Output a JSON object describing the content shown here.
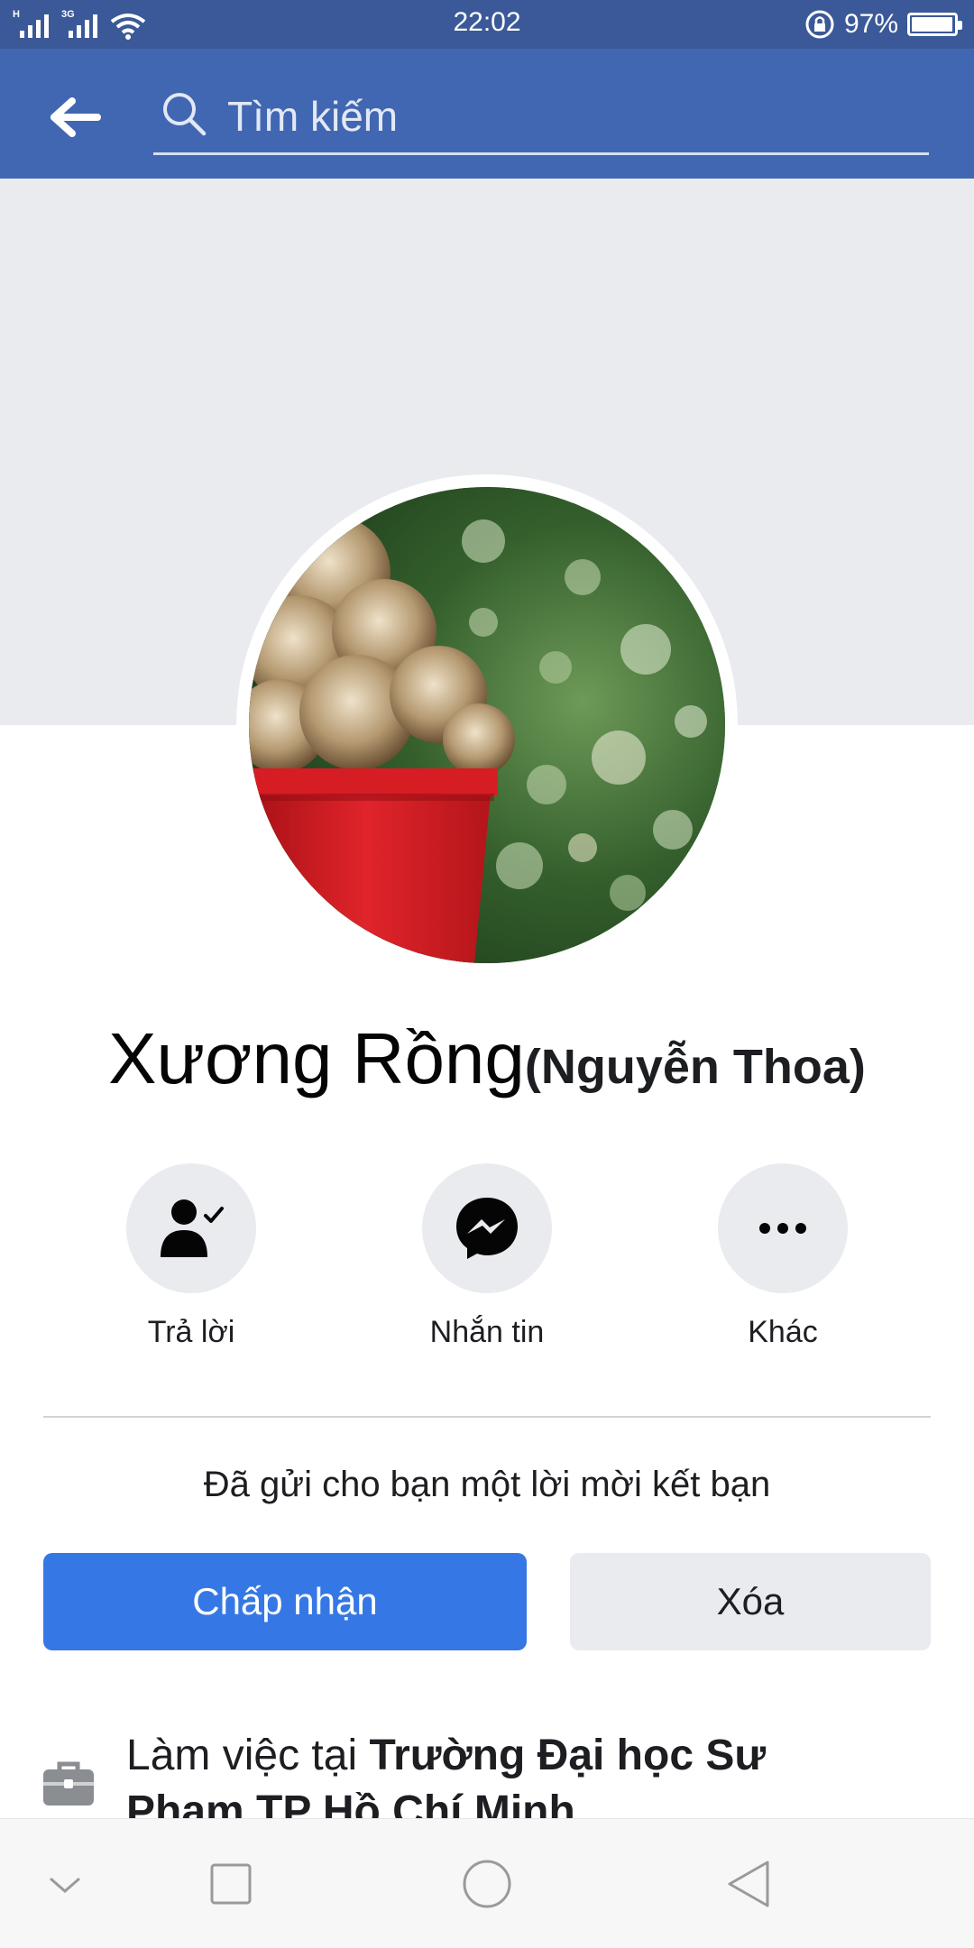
{
  "status_bar": {
    "network_1": "H",
    "network_2": "3G",
    "time": "22:02",
    "battery": "97%",
    "battery_level": 0.97
  },
  "app_bar": {
    "search_placeholder": "Tìm kiếm"
  },
  "profile": {
    "name": "Xương Rồng",
    "alternate_name": "(Nguyễn Thoa)"
  },
  "actions": [
    {
      "label": "Trả lời",
      "icon": "person-check-icon"
    },
    {
      "label": "Nhắn tin",
      "icon": "messenger-icon"
    },
    {
      "label": "Khác",
      "icon": "more-icon"
    }
  ],
  "friend_request": {
    "message": "Đã gửi cho bạn một lời mời kết bạn",
    "accept_label": "Chấp nhận",
    "delete_label": "Xóa"
  },
  "work": {
    "prefix": "Làm việc tại ",
    "place": "Trường Đại học Sư Phạm TP Hồ Chí Minh",
    "icon": "briefcase-icon"
  },
  "nav_bar": {
    "items": [
      "collapse-icon",
      "recents-icon",
      "home-icon",
      "back-icon"
    ]
  },
  "colors": {
    "status_bar": "#3b5998",
    "app_bar": "#4267b2",
    "accept": "#3578e5",
    "cover": "#e9ebee"
  }
}
